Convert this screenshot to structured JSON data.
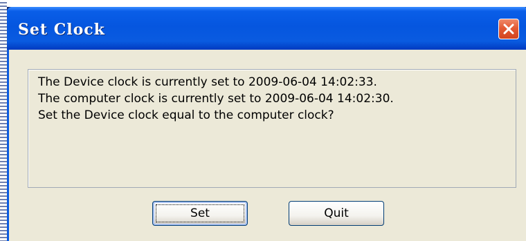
{
  "dialog": {
    "title": "Set Clock",
    "close_icon": "close-icon",
    "message": {
      "line1": "The Device clock is currently set to 2009-06-04 14:02:33.",
      "line2": "The computer clock is currently set to 2009-06-04 14:02:30.",
      "line3": "Set the Device clock equal to the computer clock?"
    },
    "buttons": {
      "set_label": "Set",
      "quit_label": "Quit"
    }
  },
  "colors": {
    "titlebar": "#0556df",
    "close_button": "#e35a35",
    "client_background": "#ece9d8"
  }
}
